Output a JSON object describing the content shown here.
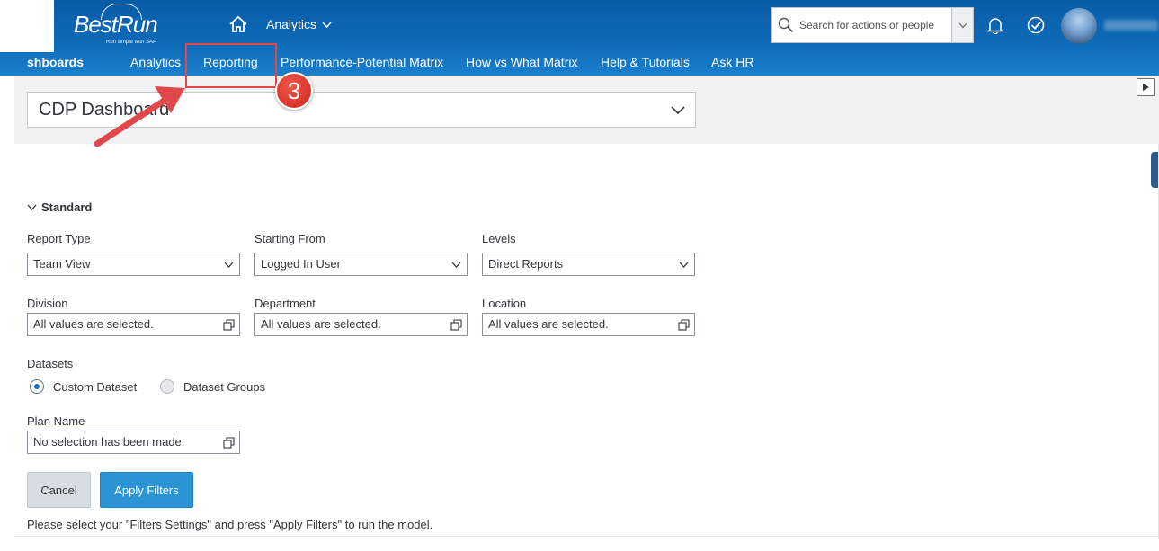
{
  "header": {
    "logo_text": "BestRun",
    "logo_tagline": "Run simple with SAP",
    "app_switch_label": "Analytics",
    "search_placeholder": "Search for actions or people"
  },
  "tabs": [
    {
      "label": "shboards",
      "active": true
    },
    {
      "label": "Analytics"
    },
    {
      "label": "Reporting"
    },
    {
      "label": "Performance-Potential Matrix"
    },
    {
      "label": "How vs What Matrix"
    },
    {
      "label": "Help & Tutorials"
    },
    {
      "label": "Ask HR"
    }
  ],
  "annotation": {
    "step_number": "3",
    "color": "#e0484b"
  },
  "dashboard": {
    "selected": "CDP Dashboard"
  },
  "filters": {
    "section_title": "Standard",
    "report_type": {
      "label": "Report Type",
      "value": "Team View"
    },
    "starting_from": {
      "label": "Starting From",
      "value": "Logged In User"
    },
    "levels": {
      "label": "Levels",
      "value": "Direct Reports"
    },
    "division": {
      "label": "Division",
      "value": "All values are selected."
    },
    "department": {
      "label": "Department",
      "value": "All values are selected."
    },
    "location": {
      "label": "Location",
      "value": "All values are selected."
    },
    "datasets": {
      "label": "Datasets",
      "options": [
        {
          "label": "Custom Dataset",
          "selected": true
        },
        {
          "label": "Dataset Groups",
          "selected": false
        }
      ]
    },
    "plan_name": {
      "label": "Plan Name",
      "value": "No selection has been made."
    }
  },
  "actions": {
    "cancel_label": "Cancel",
    "apply_label": "Apply Filters"
  },
  "hint": "Please select your \"Filters Settings\" and press \"Apply Filters\" to run the model.",
  "colors": {
    "header_blue": "#0d6ab8",
    "primary_button": "#2a94d5",
    "radio_selected": "#0a6ed1"
  }
}
